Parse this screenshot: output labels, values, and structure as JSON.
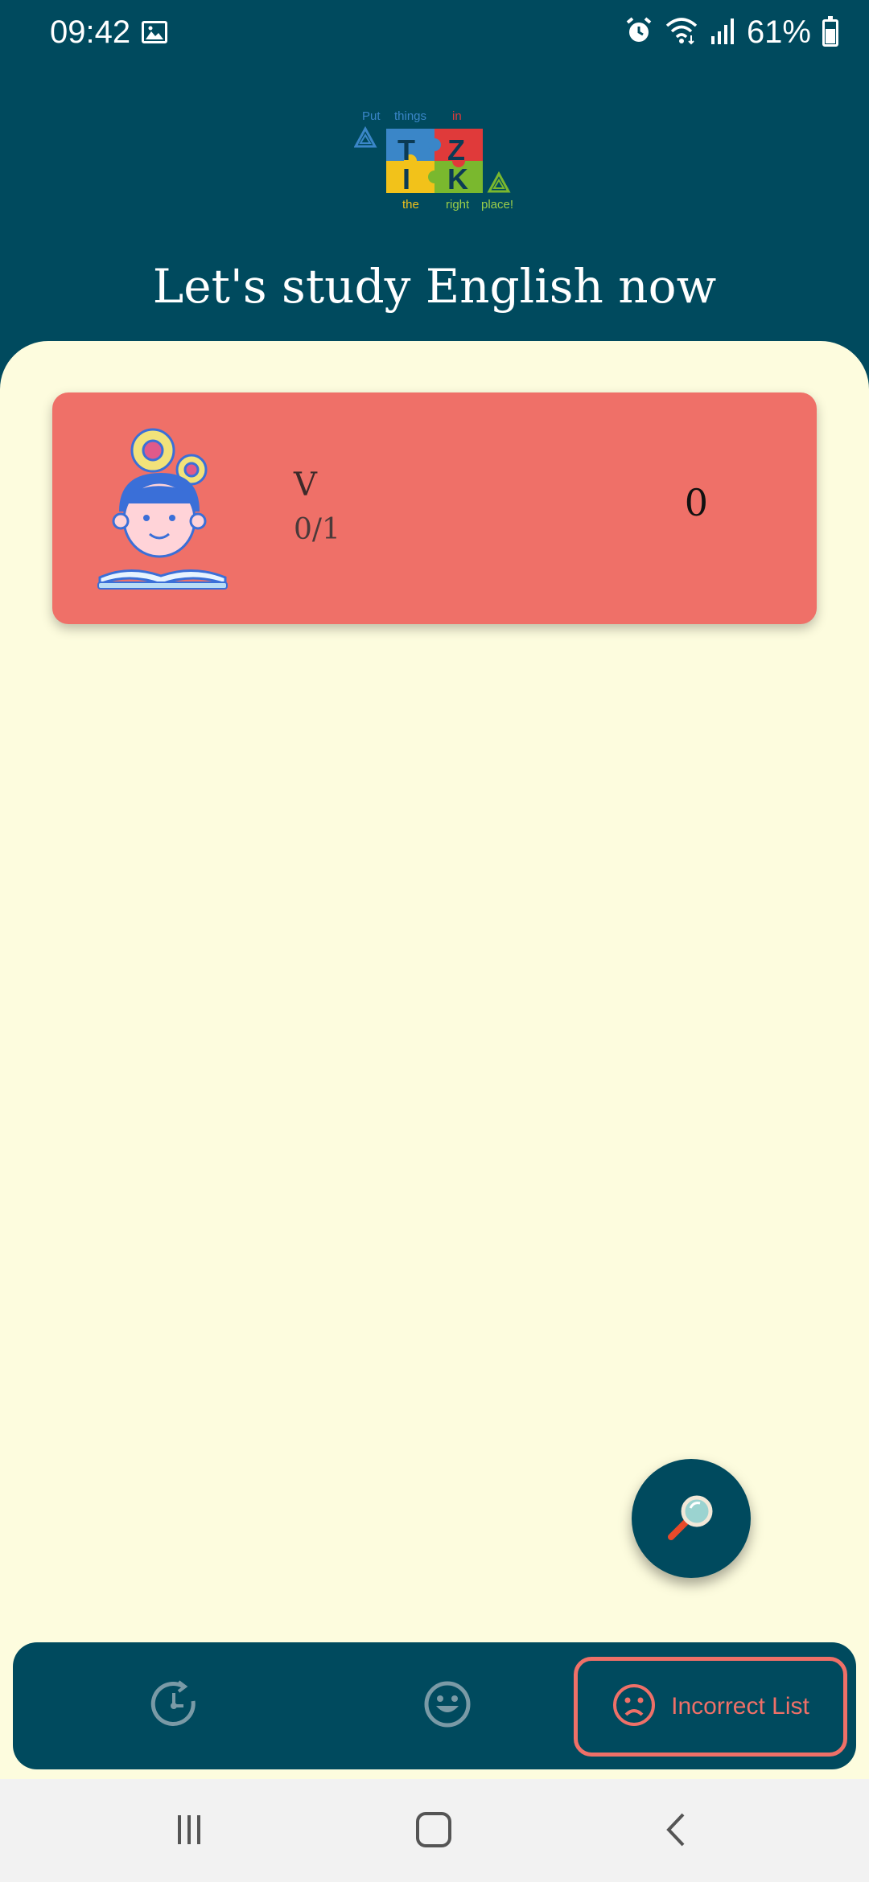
{
  "status_bar": {
    "time": "09:42",
    "battery": "61%",
    "battery_level": 0.61,
    "icons": [
      "image-icon",
      "alarm-icon",
      "wifi-icon",
      "signal-icon",
      "battery-icon"
    ]
  },
  "logo": {
    "words": [
      "Put",
      "things",
      "in",
      "the",
      "right",
      "place!"
    ],
    "letters": [
      "T",
      "Z",
      "I",
      "K"
    ],
    "colors": {
      "blue": "#3a86c8",
      "red": "#e03a3a",
      "yellow": "#f2c21a",
      "green": "#7ab82e"
    }
  },
  "header": {
    "title": "Let's study English now"
  },
  "cards": [
    {
      "title": "V",
      "progress": "0/1",
      "score": "0",
      "icon": "student-reading-icon",
      "color": "#ef7068"
    }
  ],
  "fab": {
    "icon": "magnifier-icon"
  },
  "bottom_nav": {
    "items": [
      {
        "icon": "history-icon",
        "label": ""
      },
      {
        "icon": "happy-face-icon",
        "label": ""
      },
      {
        "icon": "sad-face-icon",
        "label": "Incorrect List",
        "selected": true
      }
    ],
    "accent": "#ef7068"
  },
  "system_nav": {
    "icons": [
      "recents-icon",
      "home-icon",
      "back-icon"
    ]
  },
  "colors": {
    "primary": "#004a5e",
    "background": "#fdfcde",
    "card": "#ef7068"
  }
}
